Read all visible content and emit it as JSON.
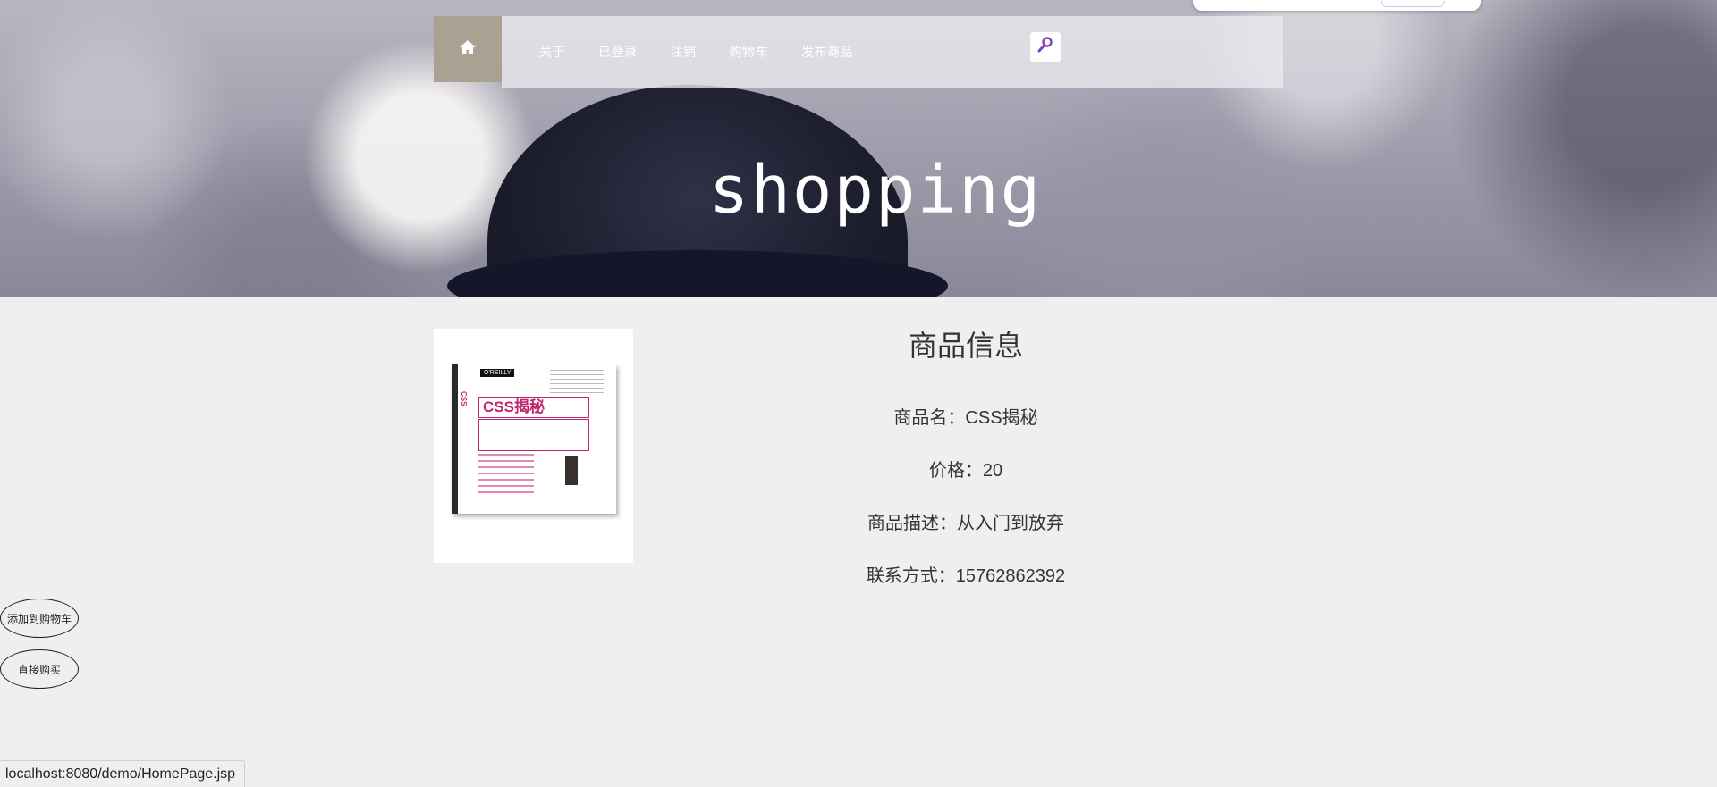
{
  "nav": {
    "links": [
      "关于",
      "已登录",
      "注销",
      "购物车",
      "发布商品"
    ]
  },
  "hero": {
    "title": "shopping"
  },
  "product": {
    "section_title": "商品信息",
    "name_line": "商品名：CSS揭秘",
    "price_line": "价格：20",
    "desc_line": "商品描述：从入门到放弃",
    "contact_line": "联系方式：15762862392",
    "image_title": "CSS揭秘"
  },
  "actions": {
    "add_to_cart": "添加到购物车",
    "buy_now": "直接购买"
  },
  "status_bar": {
    "url": "localhost:8080/demo/HomePage.jsp"
  },
  "colors": {
    "home_button": "#a9a292",
    "search_icon": "#8b3fbf",
    "book_accent": "#c0266f"
  }
}
